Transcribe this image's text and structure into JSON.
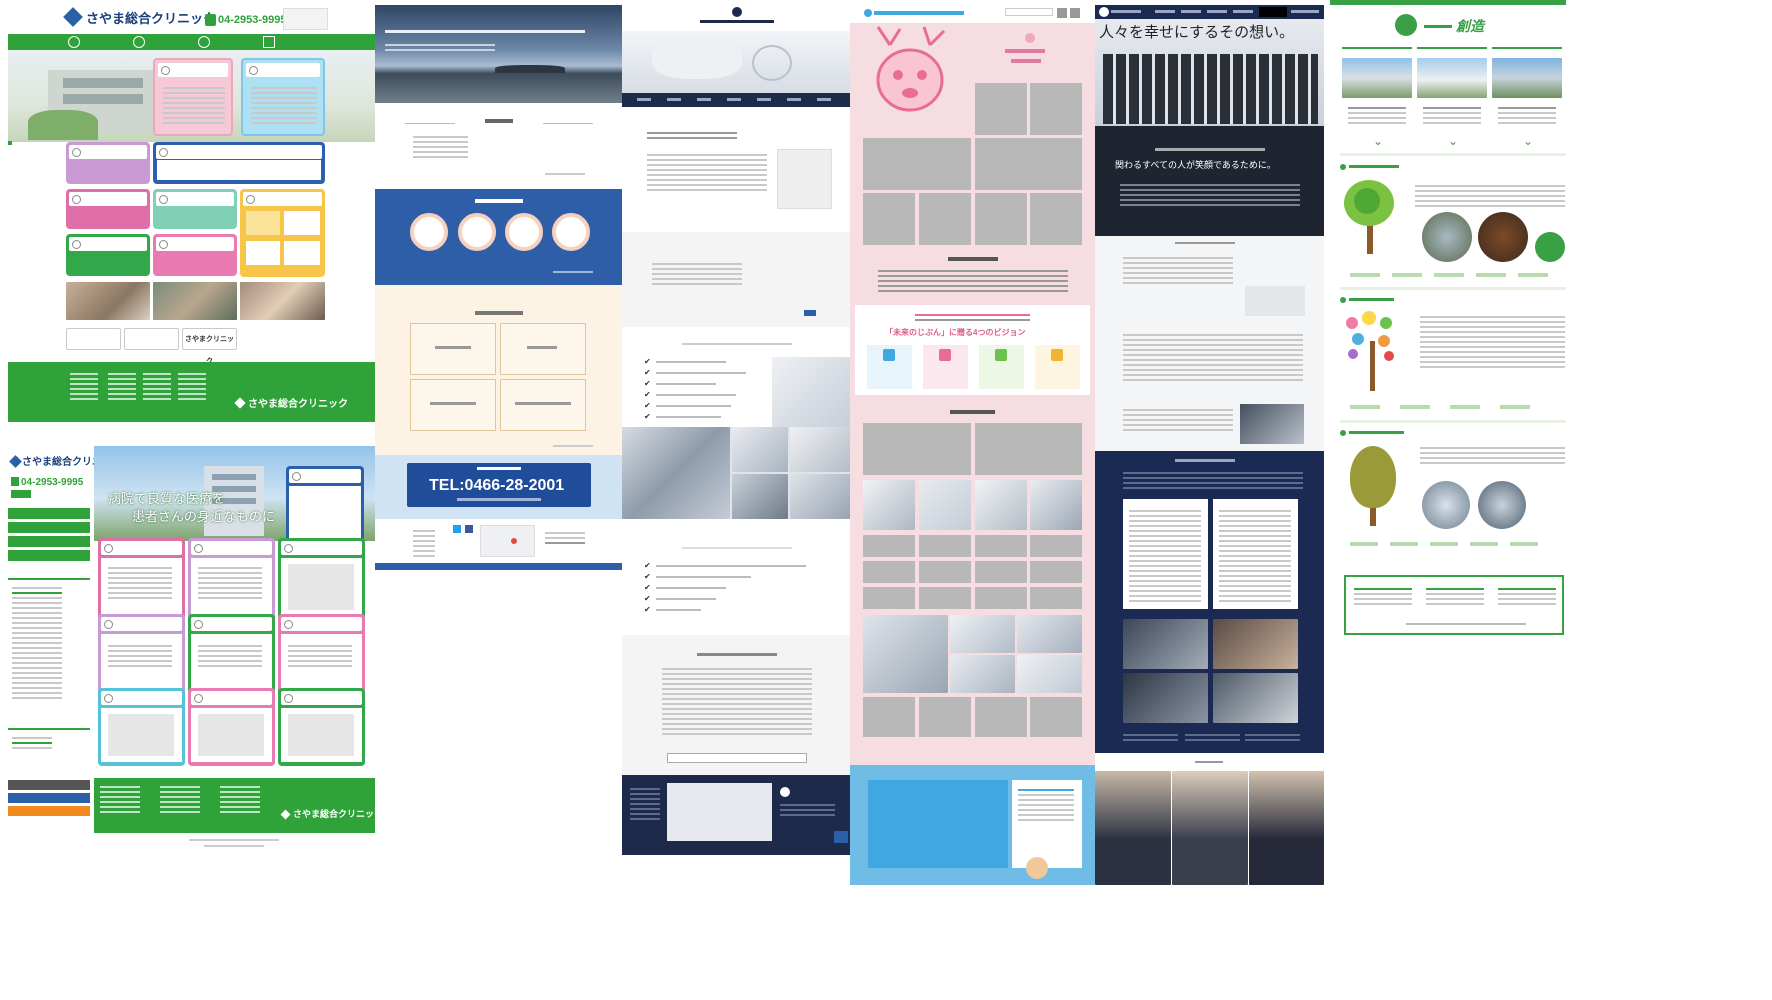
{
  "colors": {
    "clinic_green": "#2fa33a",
    "realty_blue": "#2f5ea8",
    "dental_navy": "#1d2a4a",
    "pink": "#f6dde2",
    "corporate_navy": "#1b2a52",
    "nature_green": "#3aa046"
  },
  "clinic": {
    "logo": "さやま総合クリニック",
    "phone": "04-2953-9995",
    "nav": [
      "",
      "",
      "",
      ""
    ],
    "hero_title_line1": "病院で良質な医療を",
    "hero_title_line2": "患者さんの身近なものに",
    "footer_logo": "さやま総合クリニック",
    "side_phone": "04-2953-9995",
    "bottom_buttons": [
      "",
      "",
      "さやまクリニック"
    ]
  },
  "realty": {
    "hero_text": "",
    "tel": "TEL:0466-28-2001",
    "section_title_news": "",
    "section_title_property": "",
    "section_title_consult": "",
    "consult_cards": [
      "",
      "",
      "",
      ""
    ],
    "circles": [
      "",
      "",
      "",
      ""
    ]
  },
  "dental": {
    "header_logo": "",
    "nav": [
      "",
      "",
      "",
      "",
      "",
      "",
      ""
    ]
  },
  "school": {
    "headline": "",
    "section_title": "",
    "subtitle_pink": "「未来のじぶん」に贈る4つのビジョン"
  },
  "corporate": {
    "headline": "人々を幸せにするその想い。",
    "slogan": "関わるすべての人が笑顔であるために。",
    "nav": [
      "",
      "",
      "",
      "",
      "",
      ""
    ]
  },
  "nature": {
    "title": "創造",
    "nav": [
      "",
      "",
      ""
    ]
  },
  "icons": {
    "check": "check-icon",
    "logo_mark": "logo-mark-icon",
    "phone": "phone-icon",
    "twitter": "twitter-icon",
    "facebook": "facebook-icon",
    "chevron": "chevron-down-icon",
    "page_top": "page-top-icon"
  }
}
